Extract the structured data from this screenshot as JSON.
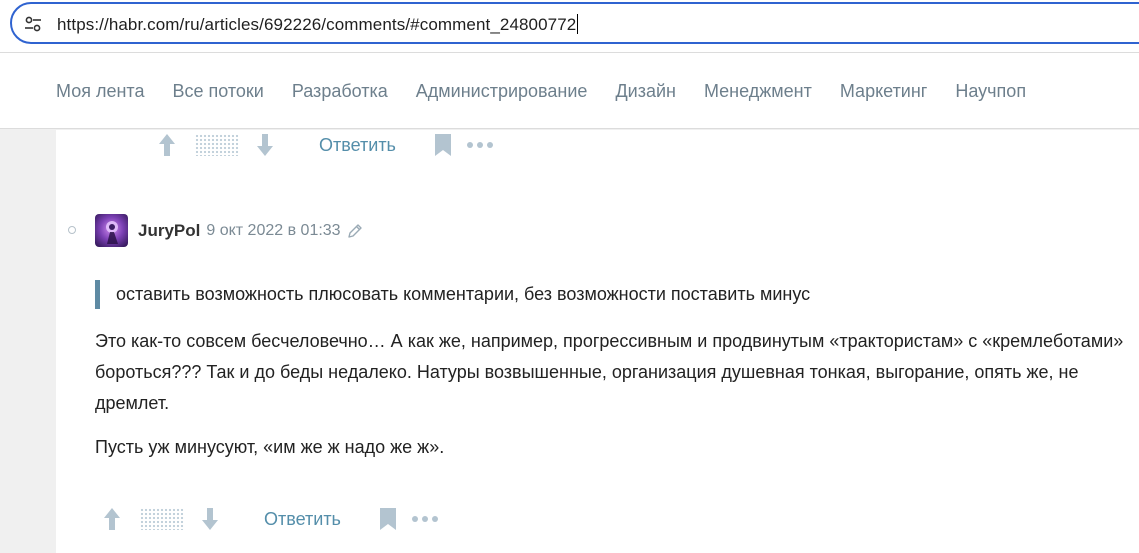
{
  "browser": {
    "url": "https://habr.com/ru/articles/692226/comments/#comment_24800772",
    "site_settings_icon": "site-settings-icon"
  },
  "nav": {
    "items": [
      "Моя лента",
      "Все потоки",
      "Разработка",
      "Администрирование",
      "Дизайн",
      "Менеджмент",
      "Маркетинг",
      "Научпоп"
    ]
  },
  "prev_comment_actions": {
    "reply_label": "Ответить"
  },
  "comment": {
    "author": "JuryPol",
    "date": "9 окт 2022 в 01:33",
    "quote": "оставить возможность плюсовать комментарии, без возможности поставить минус",
    "paragraphs": [
      "Это как-то совсем бесчеловечно… А как же, например, прогрессивным и продвинутым «трактористам» с «кремлеботами» бороться??? Так и до беды недалеко. Натуры возвышенные, организация душевная тонкая, выгорание, опять же, не дремлет.",
      "Пусть уж минусуют, «им же ж надо же ж»."
    ],
    "reply_label": "Ответить"
  },
  "colors": {
    "accent_link": "#548eaa",
    "nav_text": "#6d7f8c",
    "address_focus": "#2f63d0",
    "quote_bar": "#5e8aa3"
  }
}
